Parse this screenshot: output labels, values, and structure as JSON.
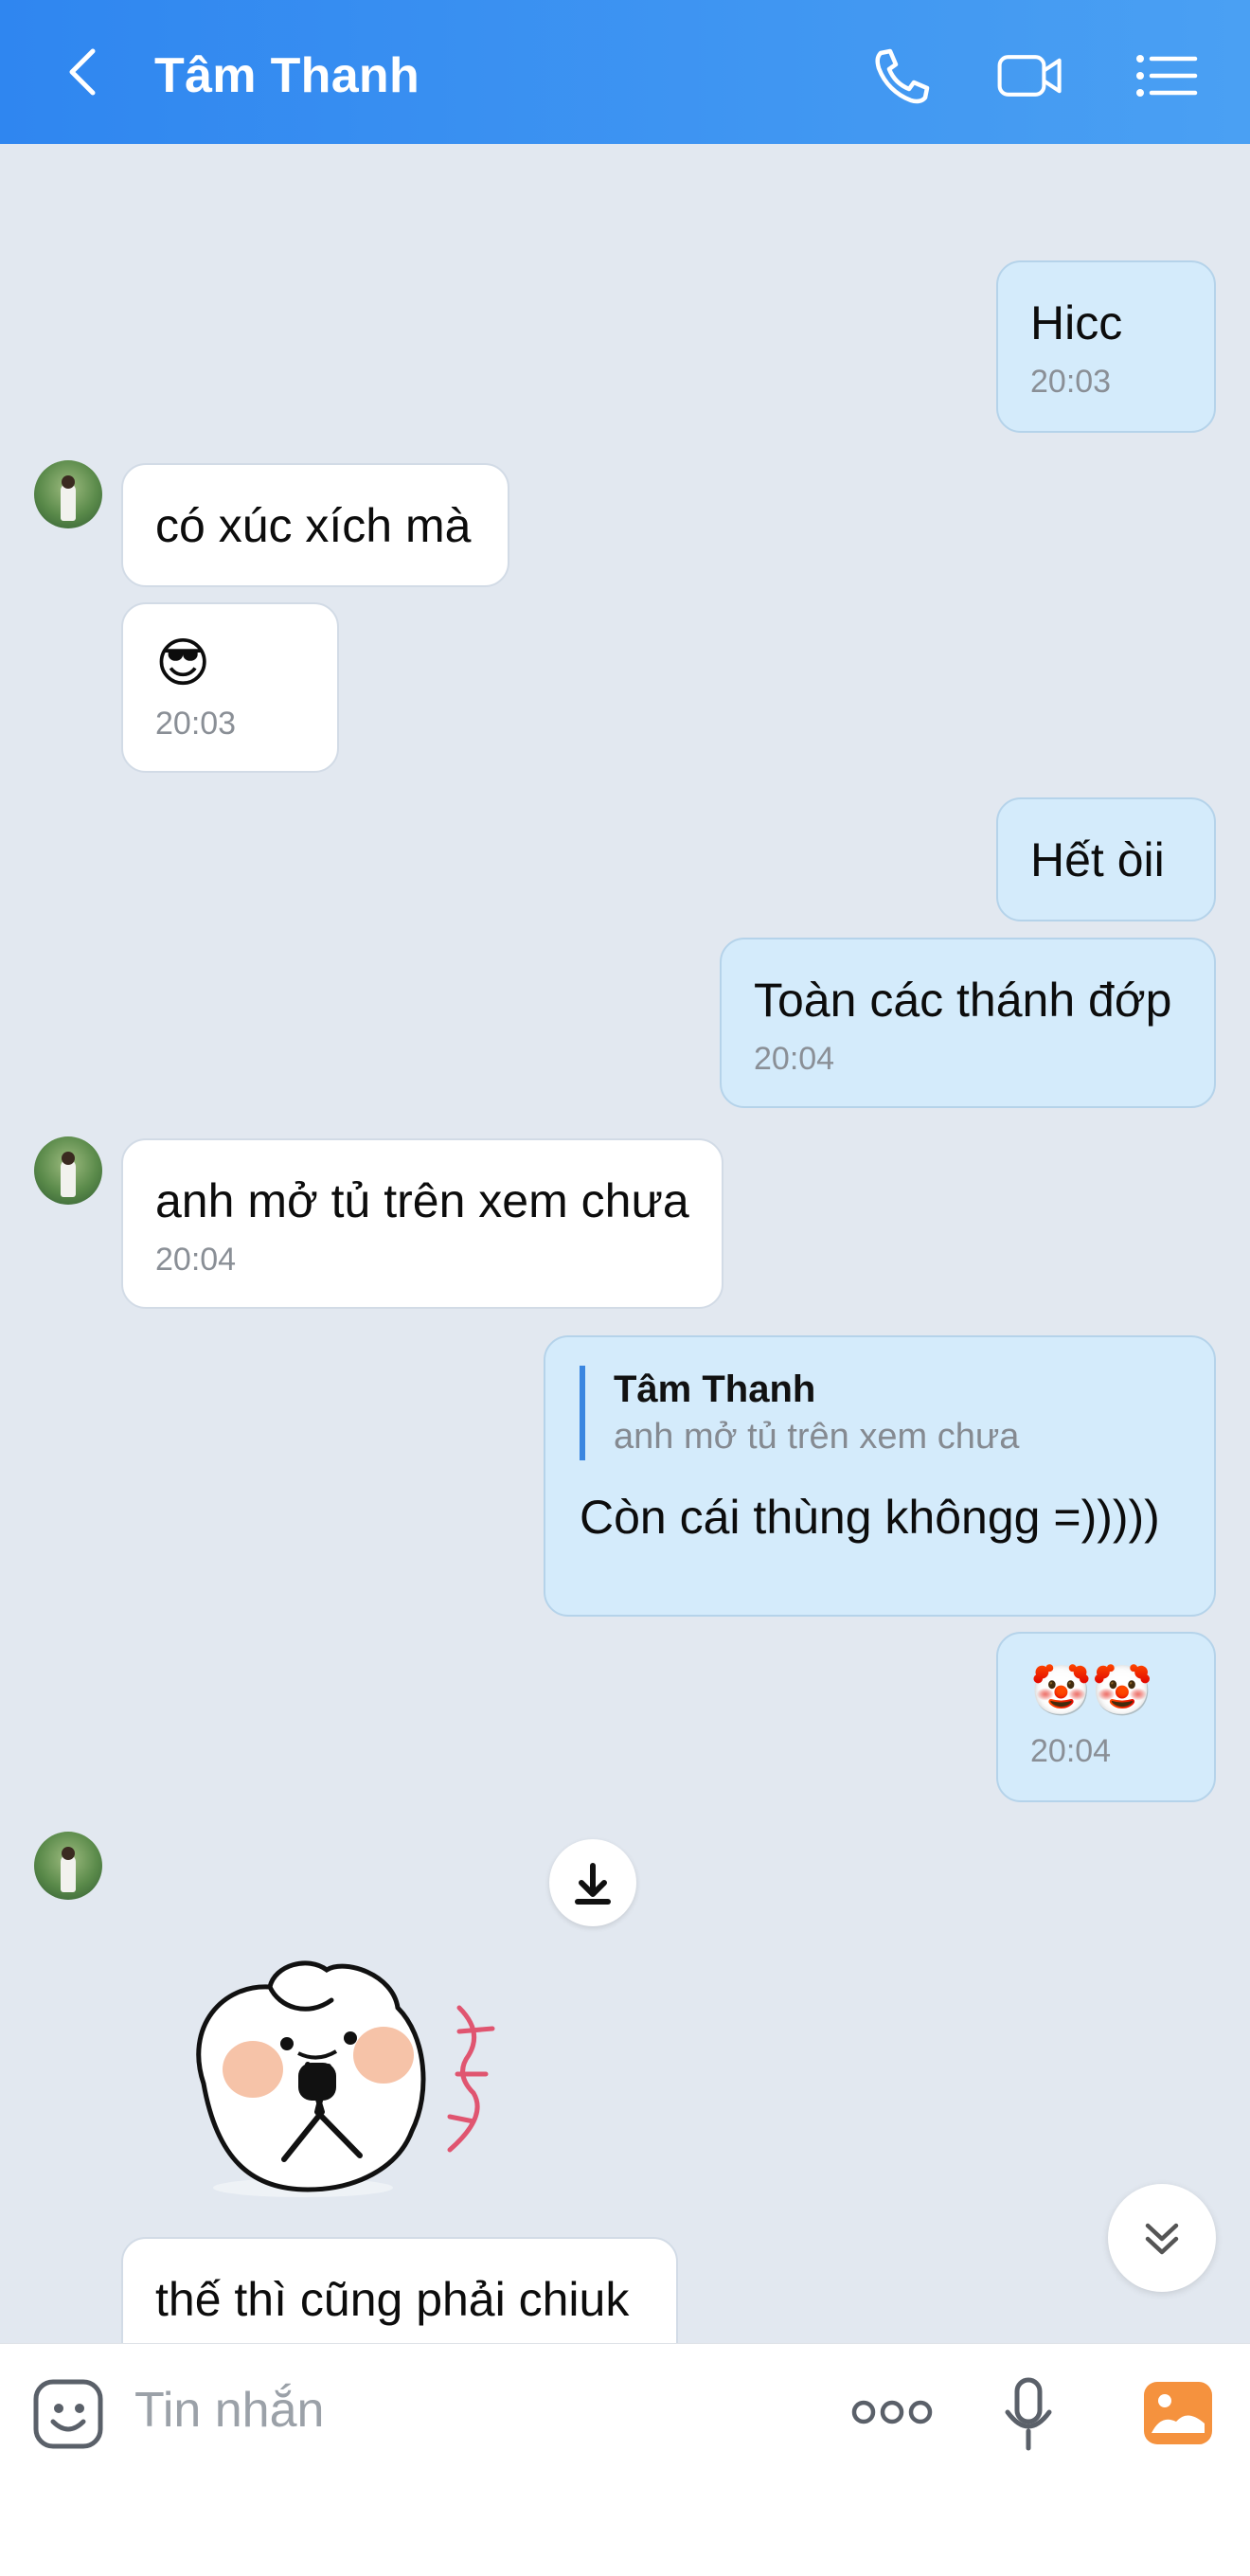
{
  "header": {
    "title": "Tâm Thanh"
  },
  "messages": {
    "m1": {
      "text": "Hicc",
      "time": "20:03"
    },
    "m2": {
      "text": "có xúc xích mà"
    },
    "m3": {
      "emoji": "😎",
      "time": "20:03"
    },
    "m4": {
      "text": "Hết òii"
    },
    "m5": {
      "text": "Toàn các thánh đớp",
      "time": "20:04"
    },
    "m6": {
      "text": "anh mở tủ trên xem chưa",
      "time": "20:04"
    },
    "m7": {
      "quote_name": "Tâm Thanh",
      "quote_text": "anh mở tủ trên xem chưa",
      "text": "Còn cái thùng khôngg =)))))"
    },
    "m8": {
      "emoji": "🤡🤡",
      "time": "20:04"
    },
    "m9": {
      "text": "thế thì cũng phải chiuk"
    }
  },
  "input": {
    "placeholder": "Tin nhắn"
  },
  "icons": [
    "back-arrow-icon",
    "phone-icon",
    "video-call-icon",
    "menu-list-icon",
    "download-icon",
    "scroll-down-icon",
    "emoji-sticker-icon",
    "more-icon",
    "microphone-icon",
    "image-gallery-icon"
  ],
  "colors": {
    "header": "#2f86f0",
    "outgoing_bubble": "#d4ebfb",
    "incoming_bubble": "#ffffff",
    "background": "#e2e8f0",
    "gallery_icon": "#f5923e"
  }
}
